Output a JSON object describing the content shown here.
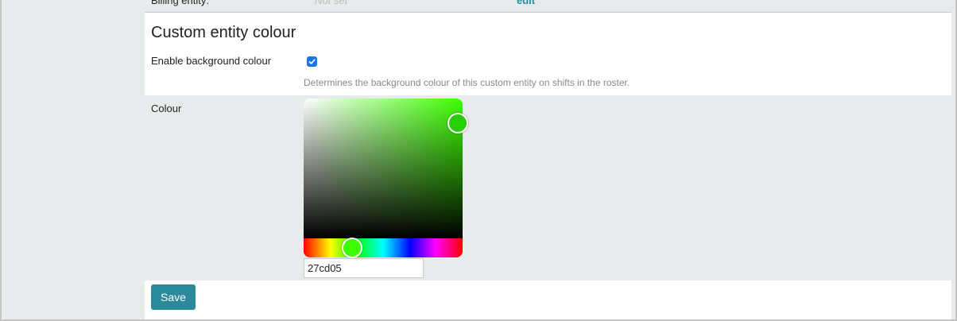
{
  "billing": {
    "label": "Billing entity:",
    "value": "Not set",
    "edit_label": "edit"
  },
  "section": {
    "title": "Custom entity colour"
  },
  "enable_background": {
    "label": "Enable background colour",
    "checked": true,
    "help": "Determines the background colour of this custom entity on shifts in the roster."
  },
  "colour": {
    "label": "Colour",
    "hex_value": "27cd05",
    "selected_color": "#27cd05",
    "hue_color": "#3dff00"
  },
  "actions": {
    "save_label": "Save"
  },
  "colors": {
    "accent": "#2a8a9b",
    "link": "#1f8fa0",
    "checkbox": "#1a73e8",
    "panel_bg": "#e8ebec"
  }
}
